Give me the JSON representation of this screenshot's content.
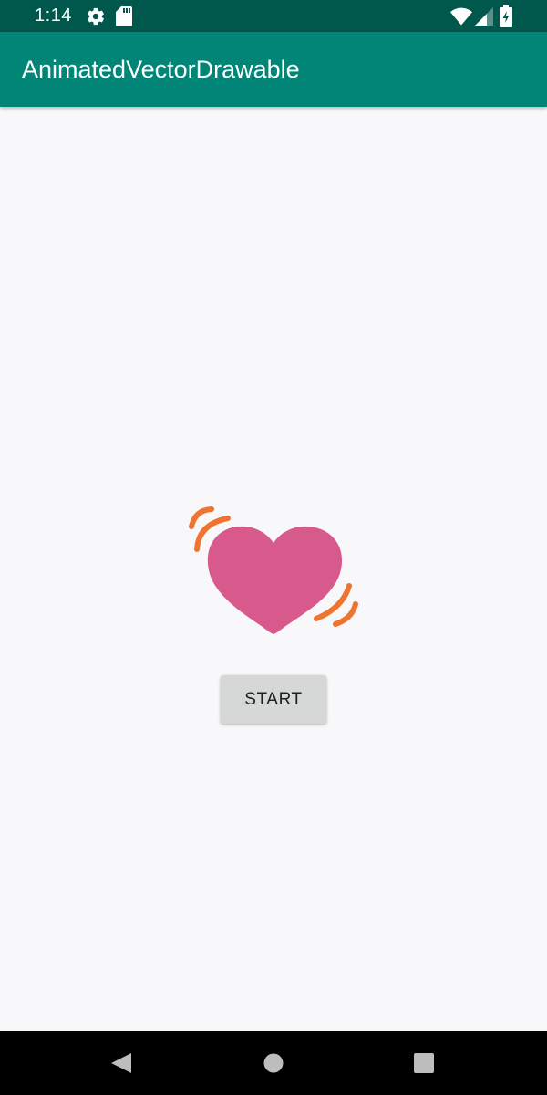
{
  "status_bar": {
    "time": "1:14",
    "icons": [
      "gear-icon",
      "sd-card-icon",
      "wifi-icon",
      "signal-icon",
      "battery-charging-icon"
    ],
    "background": "#00574b"
  },
  "app_bar": {
    "title": "AnimatedVectorDrawable",
    "background": "#008577"
  },
  "content": {
    "image_icon": "heart-icon",
    "heart_color": "#d85a8c",
    "motion_line_color": "#ee7431",
    "start_button_label": "START"
  },
  "nav_bar": {
    "icons": [
      "back-icon",
      "home-icon",
      "recents-icon"
    ]
  }
}
